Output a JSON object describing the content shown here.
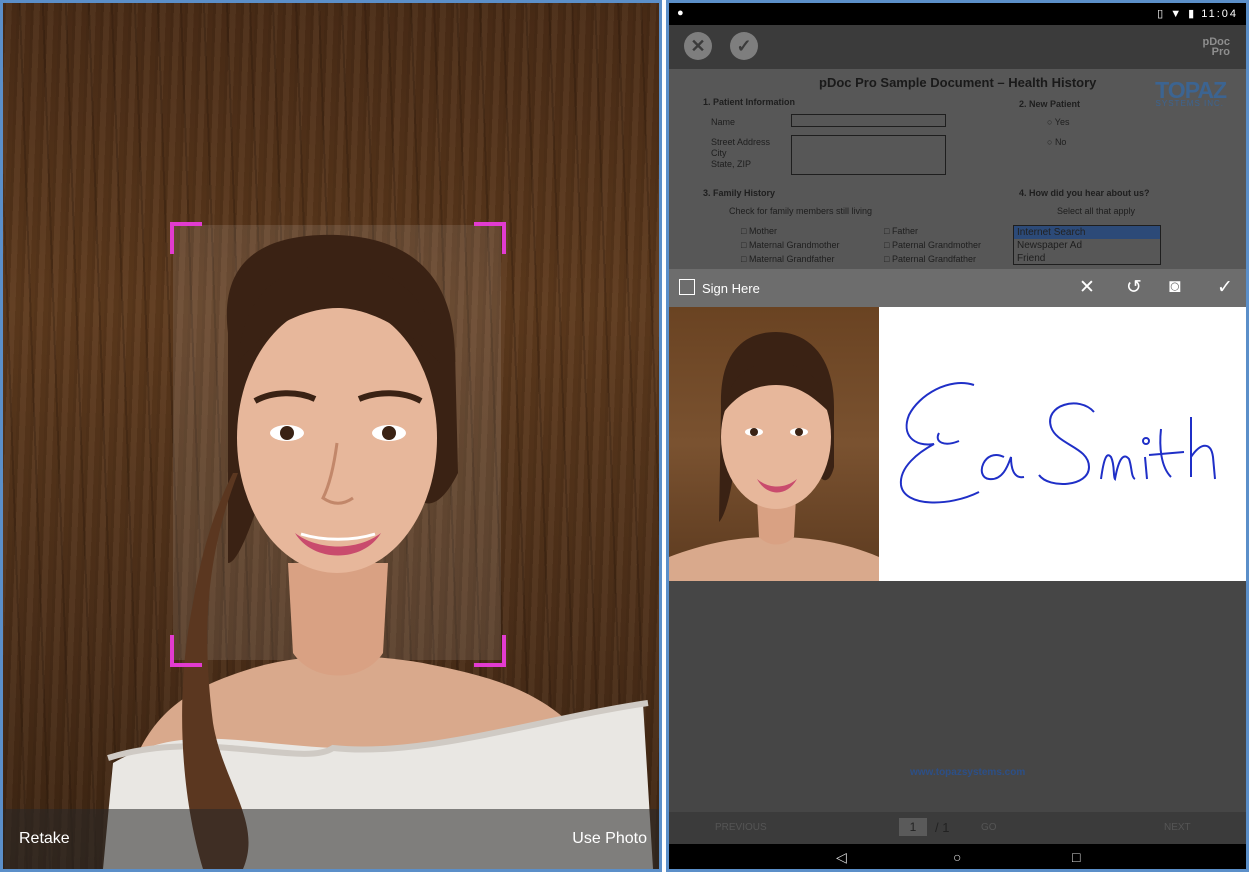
{
  "camera": {
    "retake_label": "Retake",
    "use_photo_label": "Use Photo",
    "crop_color": "#e23bd0"
  },
  "tablet": {
    "status": {
      "left_icon": "notification-icon",
      "right_icons": "vibrate-icon wifi-icon battery-icon",
      "time": "11:04"
    },
    "app": {
      "brand_line1": "pDoc",
      "brand_line2": "Pro"
    },
    "document": {
      "title": "pDoc Pro Sample Document – Health History",
      "logo": "TOPAZ",
      "logo_sub": "SYSTEMS INC.",
      "section1": "1.  Patient Information",
      "name_label": "Name",
      "street_label": "Street Address",
      "city_label": "City",
      "state_label": "State, ZIP",
      "section2": "2.  New Patient",
      "yes_label": "Yes",
      "no_label": "No",
      "section3": "3.  Family History",
      "family_hint": "Check for family members still living",
      "fam_mother": "Mother",
      "fam_mgm": "Maternal Grandmother",
      "fam_mgf": "Maternal Grandfather",
      "fam_father": "Father",
      "fam_pgm": "Paternal Grandmother",
      "fam_pgf": "Paternal Grandfather",
      "section4": "4.  How did you hear about us?",
      "hear_hint": "Select all that apply",
      "hear_options": [
        "Internet Search",
        "Newspaper Ad",
        "Friend"
      ],
      "url": "www.topazsystems.com"
    },
    "signbar": {
      "label": "Sign Here"
    },
    "signature_text": "EaSmith",
    "pager": {
      "prev": "PREVIOUS",
      "page": "1",
      "total": "/ 1",
      "go": "GO",
      "next": "NEXT"
    },
    "accent": "#5b8fc9",
    "ink_color": "#1f2fc7"
  }
}
